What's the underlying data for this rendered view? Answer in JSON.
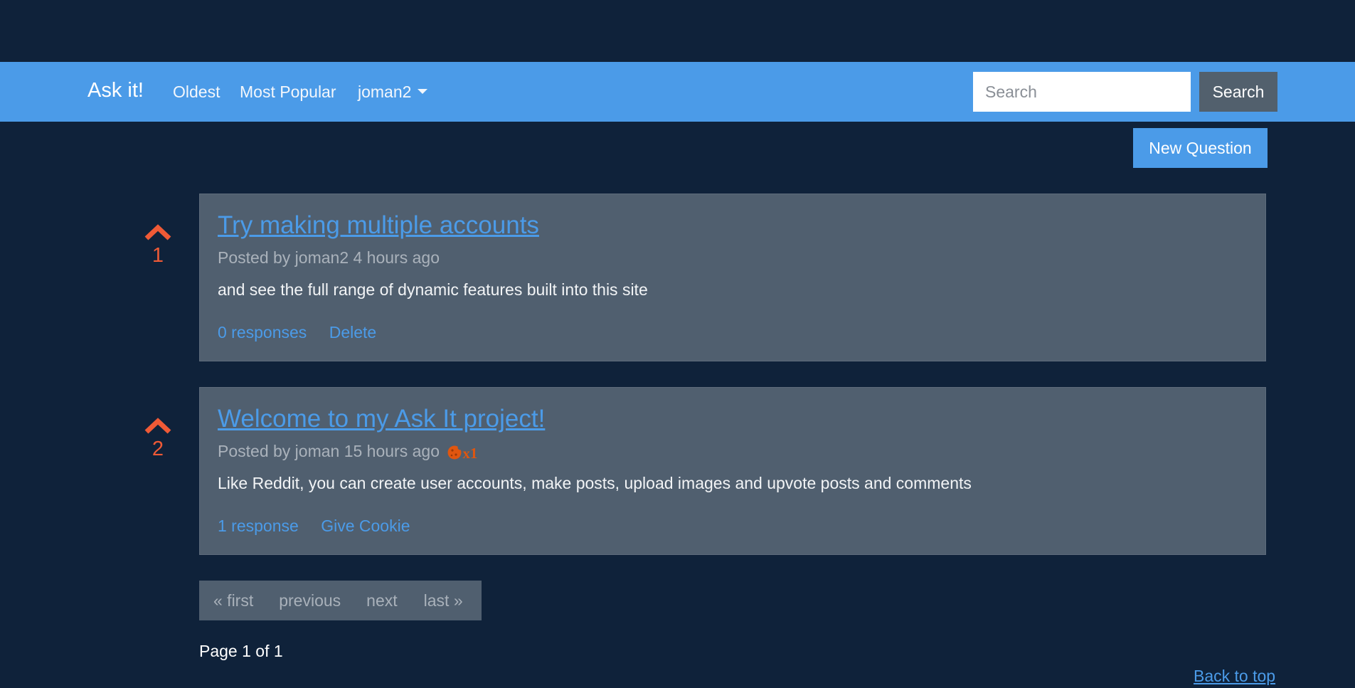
{
  "navbar": {
    "brand": "Ask it!",
    "links": [
      "Oldest",
      "Most Popular"
    ],
    "user_menu_label": "joman2",
    "search_placeholder": "Search",
    "search_button": "Search"
  },
  "new_question_label": "New Question",
  "posts": [
    {
      "votes": "1",
      "title": "Try making multiple accounts",
      "meta": "Posted by joman2 4 hours ago",
      "body": "and see the full range of dynamic features built into this site",
      "actions": [
        "0 responses",
        "Delete"
      ]
    },
    {
      "votes": "2",
      "title": "Welcome to my Ask It project!",
      "meta": "Posted by joman 15 hours ago",
      "cookie_count": "x1",
      "body": "Like Reddit, you can create user accounts, make posts, upload images and upvote posts and comments",
      "actions": [
        "1 response",
        "Give Cookie"
      ]
    }
  ],
  "pagination": {
    "links": [
      "« first",
      "previous",
      "next",
      "last »"
    ],
    "status": "Page 1 of 1"
  },
  "back_to_top": "Back to top",
  "colors": {
    "background": "#0f223a",
    "navbar": "#4b9be8",
    "card": "#505f6f",
    "link": "#4b9be8",
    "vote": "#ef5a36",
    "cookie": "#e0560f"
  },
  "icons": {
    "upvote": "chevron-up-icon",
    "dropdown": "caret-down-icon",
    "cookie": "cookie-icon"
  }
}
